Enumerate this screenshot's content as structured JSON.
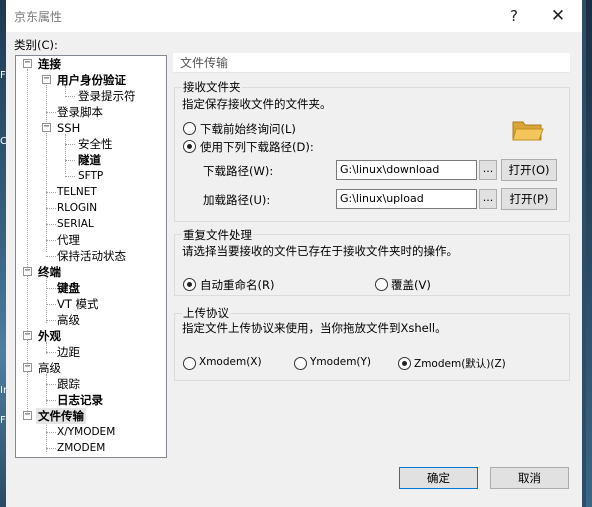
{
  "window": {
    "title": "京东属性",
    "help_label": "?",
    "close_label": "✕"
  },
  "category_label": "类别(C):",
  "tree": {
    "items": [
      {
        "label": "连接",
        "box": "−"
      },
      {
        "label": "用户身份验证",
        "box": "−"
      },
      {
        "label": "登录提示符",
        "box": ""
      },
      {
        "label": "登录脚本",
        "box": ""
      },
      {
        "label": "SSH",
        "box": "−"
      },
      {
        "label": "安全性",
        "box": ""
      },
      {
        "label": "隧道",
        "box": ""
      },
      {
        "label": "SFTP",
        "box": ""
      },
      {
        "label": "TELNET",
        "box": ""
      },
      {
        "label": "RLOGIN",
        "box": ""
      },
      {
        "label": "SERIAL",
        "box": ""
      },
      {
        "label": "代理",
        "box": ""
      },
      {
        "label": "保持活动状态",
        "box": ""
      },
      {
        "label": "终端",
        "box": "−"
      },
      {
        "label": "键盘",
        "box": ""
      },
      {
        "label": "VT 模式",
        "box": ""
      },
      {
        "label": "高级",
        "box": ""
      },
      {
        "label": "外观",
        "box": "−"
      },
      {
        "label": "边距",
        "box": ""
      },
      {
        "label": "高级",
        "box": "−"
      },
      {
        "label": "跟踪",
        "box": ""
      },
      {
        "label": "日志记录",
        "box": ""
      },
      {
        "label": "文件传输",
        "box": "−"
      },
      {
        "label": "X/YMODEM",
        "box": ""
      },
      {
        "label": "ZMODEM",
        "box": ""
      }
    ]
  },
  "panel": {
    "title": "文件传输",
    "receive": {
      "group_title": "接收文件夹",
      "description": "指定保存接收文件的文件夹。",
      "option_ask": "下载前始终询问(L)",
      "option_use": "使用下列下载路径(D):",
      "download_label": "下载路径(W):",
      "download_value": "G:\\linux\\download",
      "upload_label": "加载路径(U):",
      "upload_value": "G:\\linux\\upload",
      "browse_label": "...",
      "open_download": "打开(O)",
      "open_upload": "打开(P)",
      "folder_icon": "folder-icon"
    },
    "duplicate": {
      "group_title": "重复文件处理",
      "description": "请选择当要接收的文件已存在于接收文件夹时的操作。",
      "option_rename": "自动重命名(R)",
      "option_overwrite": "覆盖(V)"
    },
    "upload": {
      "group_title": "上传协议",
      "description": "指定文件上传协议来使用，当你拖放文件到Xshell。",
      "option_x": "Xmodem(X)",
      "option_y": "Ymodem(Y)",
      "option_z": "Zmodem(默认)(Z)"
    }
  },
  "buttons": {
    "ok": "确定",
    "cancel": "取消"
  },
  "desktop_letters": [
    "F",
    "C",
    "In",
    "F"
  ]
}
